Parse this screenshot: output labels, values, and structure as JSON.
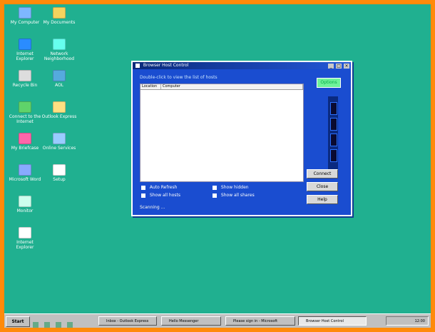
{
  "desktop": {
    "background_color": "#20b090",
    "icons": [
      {
        "label": "My Computer",
        "icon": "computer-icon",
        "color": "#7db7ff"
      },
      {
        "label": "My Documents",
        "icon": "folder-icon",
        "color": "#f4d35e"
      },
      {
        "label": "Internet Explorer",
        "icon": "browser-icon",
        "color": "#2a8cff"
      },
      {
        "label": "Network Neighborhood",
        "icon": "network-icon",
        "color": "#6fe"
      },
      {
        "label": "Recycle Bin",
        "icon": "recycle-icon",
        "color": "#ddd"
      },
      {
        "label": "AOL",
        "icon": "aol-icon",
        "color": "#5ad"
      },
      {
        "label": "Connect to the Internet",
        "icon": "globe-icon",
        "color": "#5fd36a"
      },
      {
        "label": "Outlook Express",
        "icon": "mail-icon",
        "color": "#ffe082"
      },
      {
        "label": "My Briefcase",
        "icon": "briefcase-icon",
        "color": "#f6a"
      },
      {
        "label": "Online Services",
        "icon": "online-services-icon",
        "color": "#9cf"
      },
      {
        "label": "Microsoft Word",
        "icon": "word-icon",
        "color": "#8af"
      },
      {
        "label": "Setup",
        "icon": "setup-icon",
        "color": "#fff"
      },
      {
        "label": "Monitor",
        "icon": "monitor-icon",
        "color": "#cfe"
      },
      {
        "label": "Internet Explorer",
        "icon": "setup-disk-icon",
        "color": "#fff"
      }
    ]
  },
  "window": {
    "title": "Browser Host Control",
    "hint": "Double-click to view the list of hosts",
    "list_columns": [
      "Location",
      "Computer"
    ],
    "green_button": "Options",
    "buttons": [
      "Connect",
      "Close",
      "Help"
    ],
    "checkboxes": [
      "Auto Refresh",
      "Show all hosts",
      "Show hidden",
      "Show all shares"
    ],
    "status": "Scanning ...",
    "colors": {
      "titlebar": "#0b2a7a",
      "body": "#1a4dd0",
      "accent": "#6ff29a"
    }
  },
  "taskbar": {
    "start_label": "Start",
    "tasks": [
      "Inbox - Outlook Express",
      "Hello Messenger",
      "Please sign in - Microsoft",
      "Browser Host Control"
    ],
    "tray_time": "12:00"
  }
}
